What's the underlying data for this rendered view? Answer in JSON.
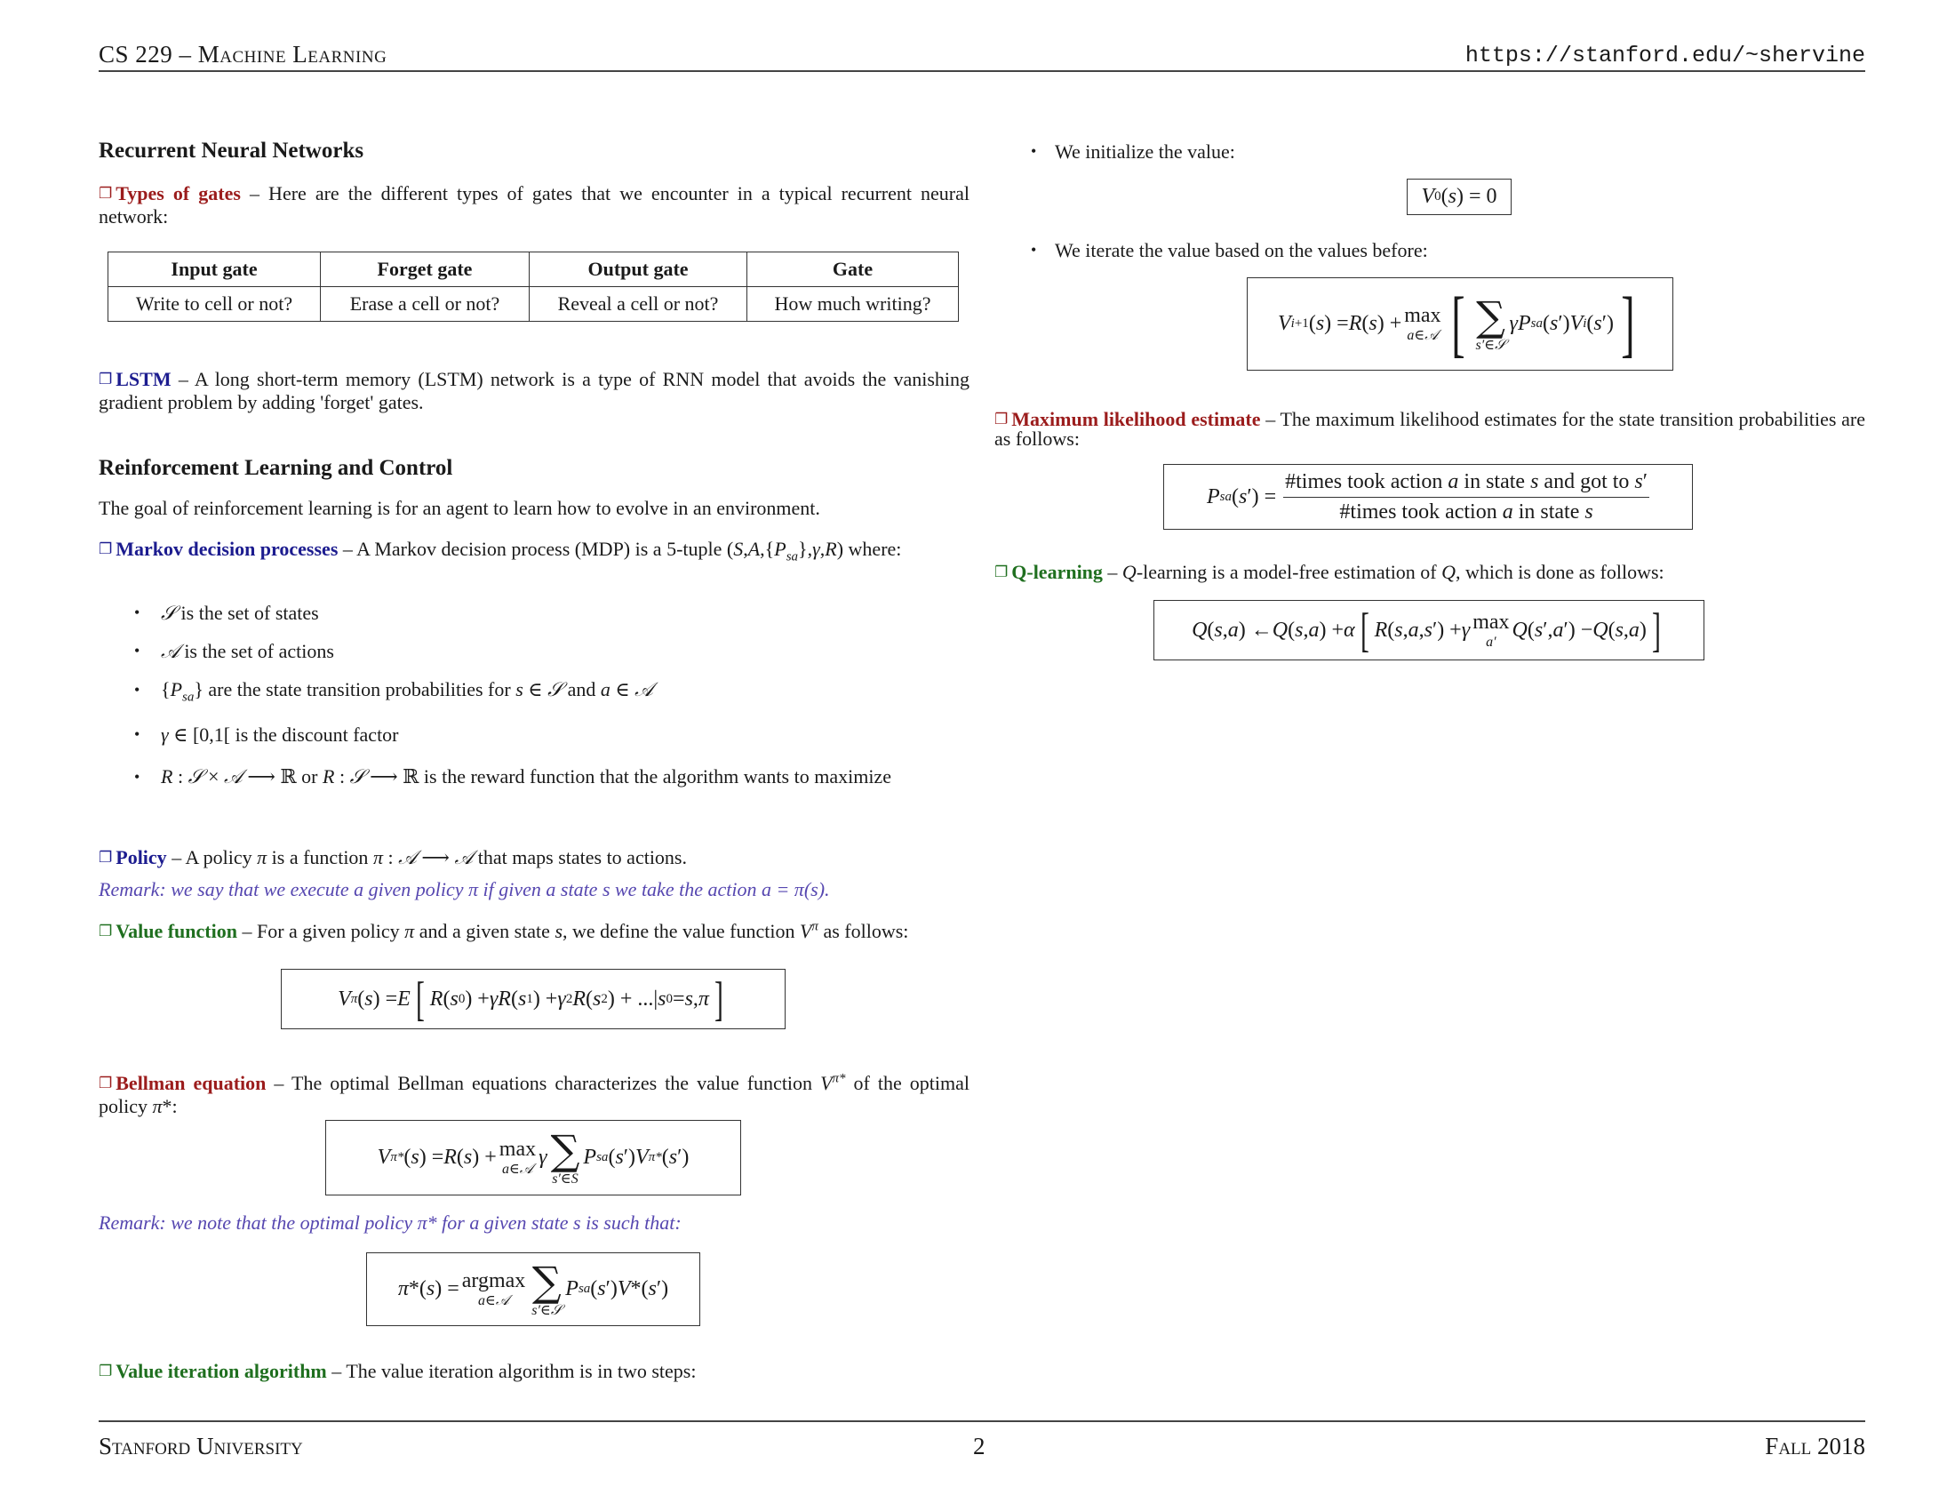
{
  "header": {
    "left": "CS 229 – Machine Learning",
    "right": "https://stanford.edu/~shervine"
  },
  "footer": {
    "left": "Stanford University",
    "page": "2",
    "right": "Fall 2018"
  },
  "colors": {
    "red": "#9b1c1c",
    "blue": "#1c1c8f",
    "green": "#1f6f1f",
    "remark": "#5647b0"
  },
  "icons": {
    "item_marker": "box-icon",
    "bullet": "bullet-icon"
  },
  "left": {
    "rnn_title": "Recurrent Neural Networks",
    "gates": {
      "keyword": "Types of gates",
      "text": "– Here are the different types of gates that we encounter in a typical recurrent neural network:",
      "table": {
        "headers": [
          "Input gate",
          "Forget gate",
          "Output gate",
          "Gate"
        ],
        "rows": [
          [
            "Write to cell or not?",
            "Erase a cell or not?",
            "Reveal a cell or not?",
            "How much writing?"
          ]
        ]
      }
    },
    "lstm": {
      "keyword": "LSTM",
      "text": "– A long short-term memory (LSTM) network is a type of RNN model that avoids the vanishing gradient problem by adding 'forget' gates."
    },
    "rl_title": "Reinforcement Learning and Control",
    "rl_intro": "The goal of reinforcement learning is for an agent to learn how to evolve in an environment.",
    "mdp": {
      "keyword": "Markov decision processes",
      "text": "– A Markov decision process (MDP) is a 5-tuple (S,A,{Psa},γ,R) where:",
      "bullets": [
        "𝒮 is the set of states",
        "𝒜 is the set of actions",
        "{Psa} are the state transition probabilities for s ∈ 𝒮 and a ∈ 𝒜",
        "γ ∈ [0,1[ is the discount factor",
        "R : 𝒮 × 𝒜 ⟶ ℝ or R : 𝒮 ⟶ ℝ is the reward function that the algorithm wants to maximize"
      ]
    },
    "policy": {
      "keyword": "Policy",
      "text": "– A policy π is a function π : 𝒮 ⟶ 𝒜 that maps states to actions.",
      "remark": "Remark: we say that we execute a given policy π if given a state s we take the action a = π(s)."
    },
    "value_function": {
      "keyword": "Value function",
      "text": "– For a given policy π and a given state s, we define the value function Vπ as follows:",
      "equation": "Vπ(s) = E[R(s0) + γR(s1) + γ²R(s2) + ...|s0 = s,π]"
    },
    "bellman": {
      "keyword": "Bellman equation",
      "text": "– The optimal Bellman equations characterizes the value function Vπ* of the optimal policy π*:",
      "equation": "Vπ*(s) = R(s) + max_{a∈𝒜} γ Σ_{s'∈S} Psa(s')Vπ*(s')",
      "remark": "Remark: we note that the optimal policy π* for a given state s is such that:",
      "policy_equation": "π*(s) = argmax_{a∈𝒜} Σ_{s'∈𝒮} Psa(s')V*(s')"
    },
    "value_iteration": {
      "keyword": "Value iteration algorithm",
      "text": "– The value iteration algorithm is in two steps:"
    }
  },
  "right": {
    "steps": [
      {
        "text": "We initialize the value:",
        "equation": "V0(s) = 0"
      },
      {
        "text": "We iterate the value based on the values before:",
        "equation": "Vi+1(s) = R(s) + max_{a∈𝒜} [Σ_{s'∈𝒮} γPsa(s')Vi(s')]"
      }
    ],
    "mle": {
      "keyword": "Maximum likelihood estimate",
      "text": "– The maximum likelihood estimates for the state transition probabilities are as follows:",
      "lhs": "Psa(s') =",
      "numerator": "#times took action a in state s and got to s'",
      "denominator": "#times took action a in state s"
    },
    "qlearning": {
      "keyword": "Q-learning",
      "text": "– Q-learning is a model-free estimation of Q, which is done as follows:",
      "equation": "Q(s,a) ← Q(s,a) + α[R(s,a,s') + γ max_{a'} Q(s',a') − Q(s,a)]"
    }
  }
}
